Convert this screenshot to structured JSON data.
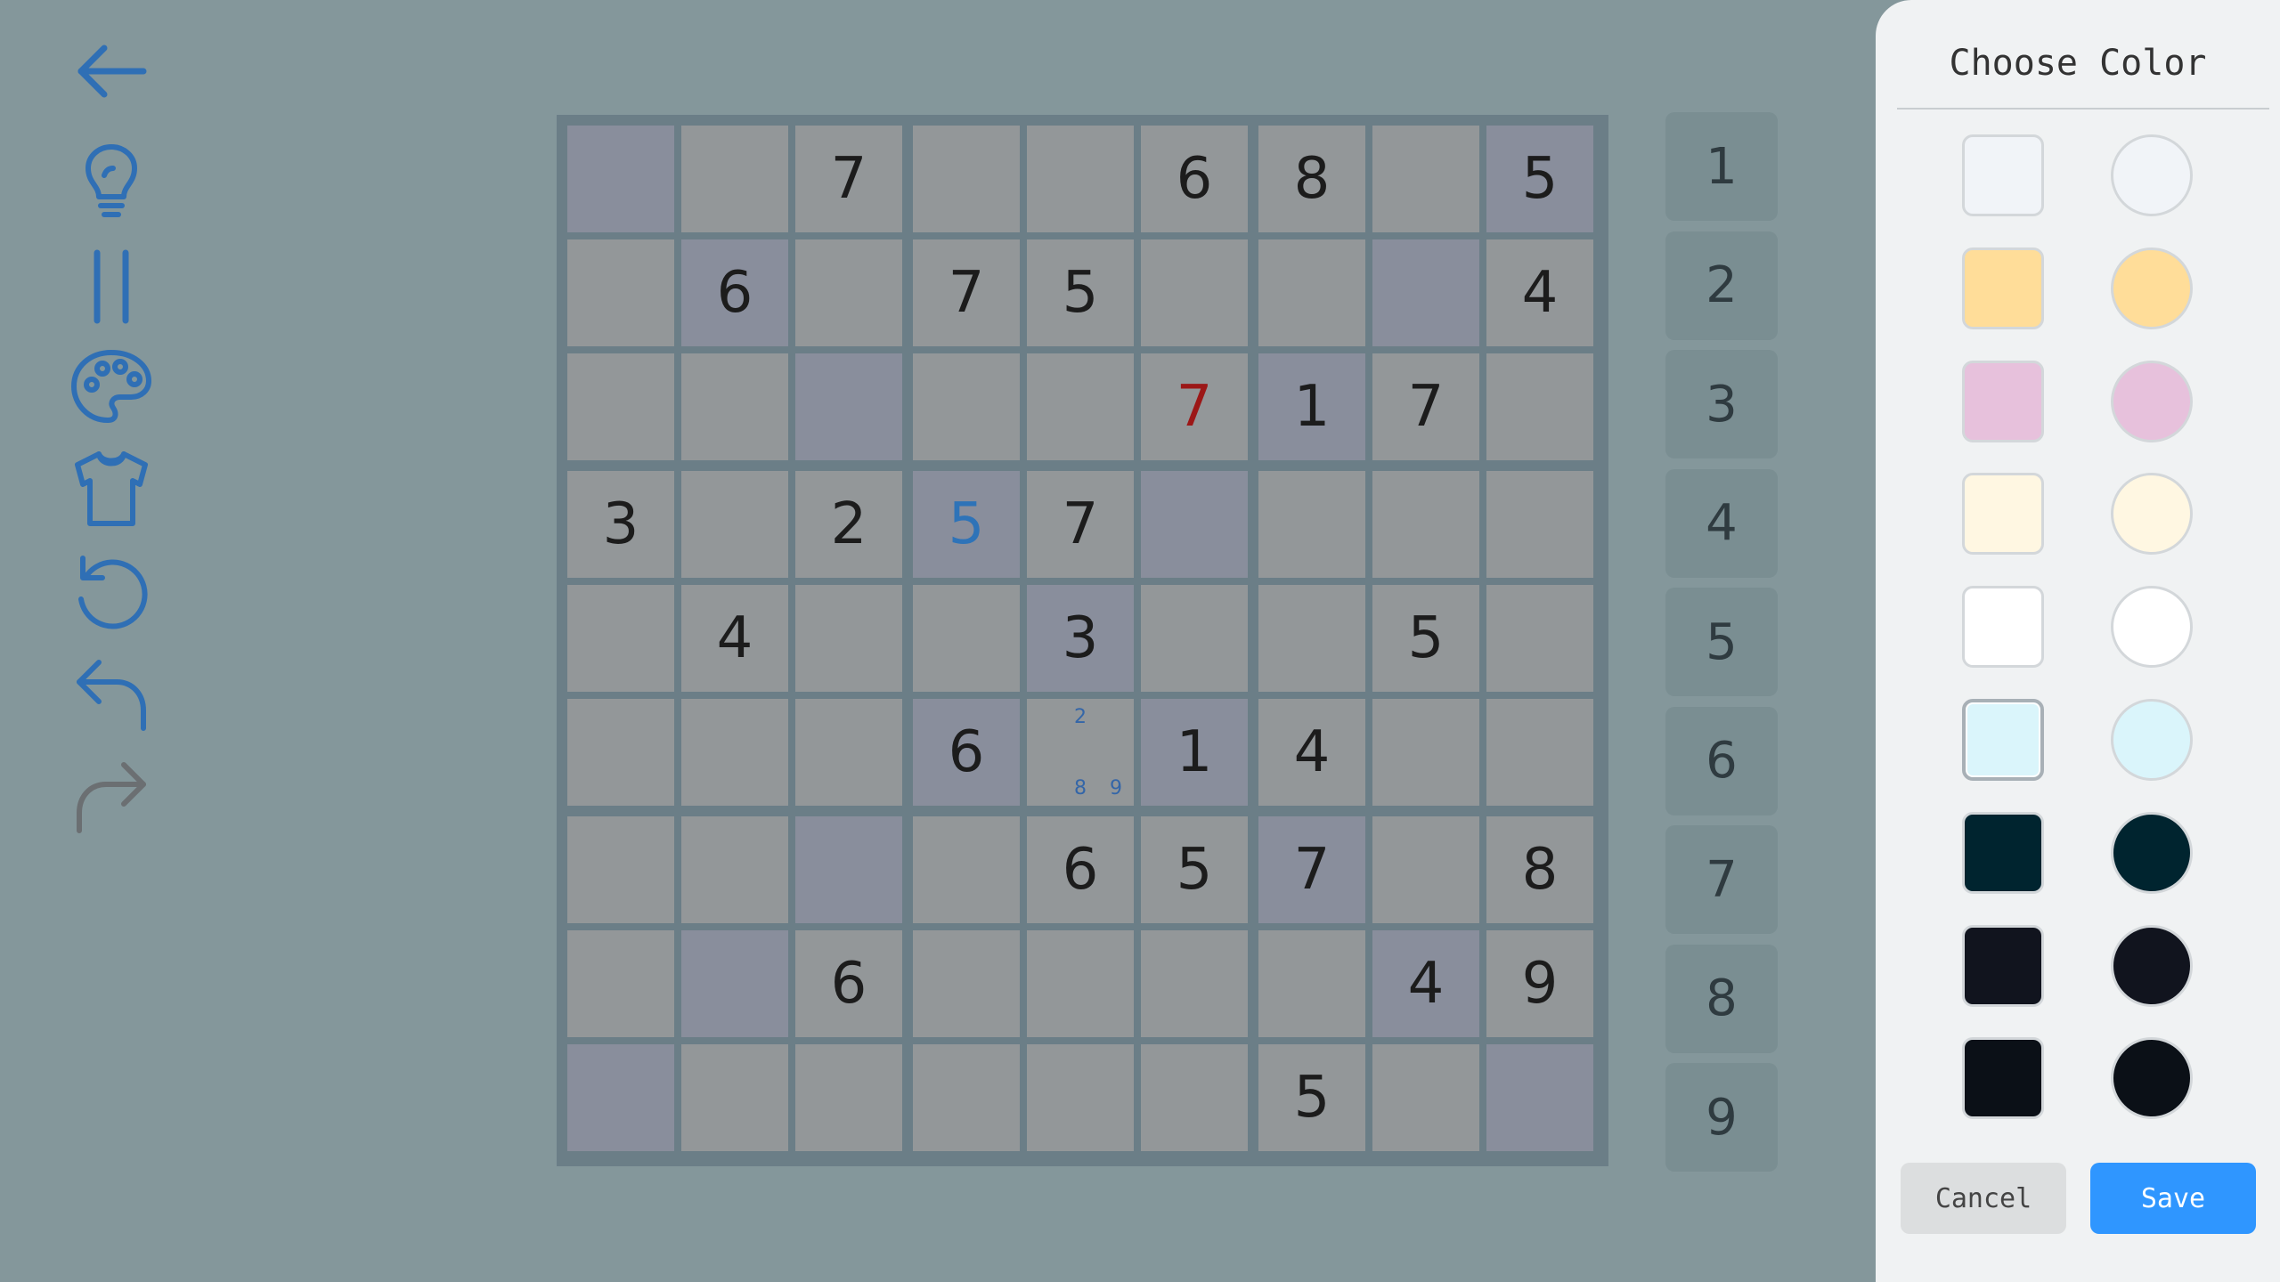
{
  "toolbar": {
    "icons": [
      "back-arrow-icon",
      "lightbulb-icon",
      "pause-icon",
      "palette-icon",
      "shirt-icon",
      "restart-icon",
      "undo-icon",
      "redo-icon"
    ],
    "color": "#2f6fb5",
    "disabled_color": "#6b6f72"
  },
  "board": {
    "rows": [
      [
        "",
        "",
        "7",
        "",
        "",
        "6",
        "8",
        "",
        "5"
      ],
      [
        "",
        "6",
        "",
        "7",
        "5",
        "",
        "",
        "",
        "4"
      ],
      [
        "",
        "",
        "",
        "",
        "",
        "7",
        "1",
        "7",
        ""
      ],
      [
        "3",
        "",
        "2",
        "5",
        "7",
        "",
        "",
        "",
        ""
      ],
      [
        "",
        "4",
        "",
        "",
        "3",
        "",
        "",
        "5",
        ""
      ],
      [
        "",
        "",
        "",
        "6",
        "",
        "1",
        "4",
        "",
        ""
      ],
      [
        "",
        "",
        "",
        "",
        "6",
        "5",
        "7",
        "",
        "8"
      ],
      [
        "",
        "",
        "6",
        "",
        "",
        "",
        "",
        "4",
        "9"
      ],
      [
        "",
        "",
        "",
        "",
        "",
        "",
        "5",
        "",
        ""
      ]
    ],
    "highlighted": [
      [
        0,
        0
      ],
      [
        0,
        8
      ],
      [
        1,
        1
      ],
      [
        1,
        7
      ],
      [
        2,
        2
      ],
      [
        2,
        6
      ],
      [
        3,
        3
      ],
      [
        3,
        5
      ],
      [
        4,
        4
      ],
      [
        5,
        3
      ],
      [
        5,
        5
      ],
      [
        6,
        2
      ],
      [
        6,
        6
      ],
      [
        7,
        1
      ],
      [
        7,
        7
      ],
      [
        8,
        0
      ],
      [
        8,
        8
      ]
    ],
    "error_cells": [
      [
        2,
        5
      ]
    ],
    "user_cells": [
      [
        3,
        3
      ]
    ],
    "notes": [
      {
        "row": 5,
        "col": 4,
        "values": [
          "2",
          "8",
          "9"
        ]
      }
    ],
    "colors": {
      "cell": "#939799",
      "highlight": "#898e9c",
      "given": "#1c1c1c",
      "error": "#9c1717",
      "user": "#2e73b8"
    }
  },
  "numpad": {
    "keys": [
      "1",
      "2",
      "3",
      "4",
      "5",
      "6",
      "7",
      "8",
      "9"
    ]
  },
  "color_panel": {
    "title": "Choose Color",
    "colors": [
      "#f1f4f8",
      "#ffdd99",
      "#e7c1dc",
      "#fff7e2",
      "#ffffff",
      "#daf5fb",
      "#00242f",
      "#11141e",
      "#0b1017"
    ],
    "selected_index": 5,
    "cancel_label": "Cancel",
    "save_label": "Save"
  }
}
